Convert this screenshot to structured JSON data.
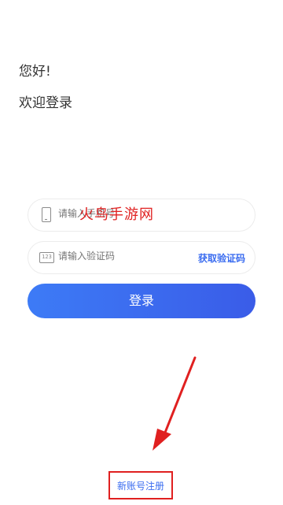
{
  "header": {
    "greeting": "您好!",
    "welcome": "欢迎登录"
  },
  "form": {
    "phone_placeholder": "请输入手机号",
    "code_placeholder": "请输入验证码",
    "code_icon_text": "123",
    "get_code_label": "获取验证码",
    "login_label": "登录"
  },
  "footer": {
    "register_label": "新账号注册"
  },
  "overlay": {
    "watermark": "火鸟手游网"
  },
  "colors": {
    "accent": "#3a6cf0",
    "annotation_red": "#e02020"
  },
  "icons": {
    "phone": "phone-icon",
    "code": "code-icon",
    "annotation_arrow": "arrow-icon"
  }
}
